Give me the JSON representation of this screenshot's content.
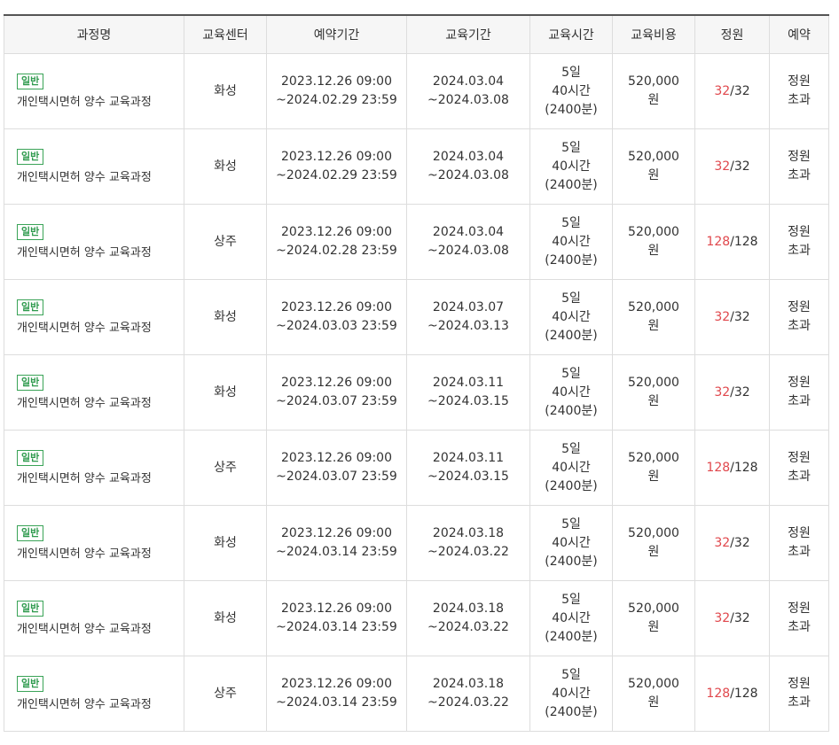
{
  "headers": [
    "과정명",
    "교육센터",
    "예약기간",
    "교육기간",
    "교육시간",
    "교육비용",
    "정원",
    "예약"
  ],
  "rows": [
    {
      "badge": "일반",
      "course": "개인택시면허 양수 교육과정",
      "center": "화성",
      "reserve_start": "2023.12.26 09:00",
      "reserve_end": "~2024.02.29 23:59",
      "edu_start": "2024.03.04",
      "edu_end": "~2024.03.08",
      "time_days": "5일",
      "time_hours": "40시간",
      "time_minutes": "(2400분)",
      "cost_amount": "520,000",
      "cost_unit": "원",
      "cap_current": "32",
      "cap_total": "/32",
      "status_1": "정원",
      "status_2": "초과"
    },
    {
      "badge": "일반",
      "course": "개인택시면허 양수 교육과정",
      "center": "화성",
      "reserve_start": "2023.12.26 09:00",
      "reserve_end": "~2024.02.29 23:59",
      "edu_start": "2024.03.04",
      "edu_end": "~2024.03.08",
      "time_days": "5일",
      "time_hours": "40시간",
      "time_minutes": "(2400분)",
      "cost_amount": "520,000",
      "cost_unit": "원",
      "cap_current": "32",
      "cap_total": "/32",
      "status_1": "정원",
      "status_2": "초과"
    },
    {
      "badge": "일반",
      "course": "개인택시면허 양수 교육과정",
      "center": "상주",
      "reserve_start": "2023.12.26 09:00",
      "reserve_end": "~2024.02.28 23:59",
      "edu_start": "2024.03.04",
      "edu_end": "~2024.03.08",
      "time_days": "5일",
      "time_hours": "40시간",
      "time_minutes": "(2400분)",
      "cost_amount": "520,000",
      "cost_unit": "원",
      "cap_current": "128",
      "cap_total": "/128",
      "status_1": "정원",
      "status_2": "초과"
    },
    {
      "badge": "일반",
      "course": "개인택시면허 양수 교육과정",
      "center": "화성",
      "reserve_start": "2023.12.26 09:00",
      "reserve_end": "~2024.03.03 23:59",
      "edu_start": "2024.03.07",
      "edu_end": "~2024.03.13",
      "time_days": "5일",
      "time_hours": "40시간",
      "time_minutes": "(2400분)",
      "cost_amount": "520,000",
      "cost_unit": "원",
      "cap_current": "32",
      "cap_total": "/32",
      "status_1": "정원",
      "status_2": "초과"
    },
    {
      "badge": "일반",
      "course": "개인택시면허 양수 교육과정",
      "center": "화성",
      "reserve_start": "2023.12.26 09:00",
      "reserve_end": "~2024.03.07 23:59",
      "edu_start": "2024.03.11",
      "edu_end": "~2024.03.15",
      "time_days": "5일",
      "time_hours": "40시간",
      "time_minutes": "(2400분)",
      "cost_amount": "520,000",
      "cost_unit": "원",
      "cap_current": "32",
      "cap_total": "/32",
      "status_1": "정원",
      "status_2": "초과"
    },
    {
      "badge": "일반",
      "course": "개인택시면허 양수 교육과정",
      "center": "상주",
      "reserve_start": "2023.12.26 09:00",
      "reserve_end": "~2024.03.07 23:59",
      "edu_start": "2024.03.11",
      "edu_end": "~2024.03.15",
      "time_days": "5일",
      "time_hours": "40시간",
      "time_minutes": "(2400분)",
      "cost_amount": "520,000",
      "cost_unit": "원",
      "cap_current": "128",
      "cap_total": "/128",
      "status_1": "정원",
      "status_2": "초과"
    },
    {
      "badge": "일반",
      "course": "개인택시면허 양수 교육과정",
      "center": "화성",
      "reserve_start": "2023.12.26 09:00",
      "reserve_end": "~2024.03.14 23:59",
      "edu_start": "2024.03.18",
      "edu_end": "~2024.03.22",
      "time_days": "5일",
      "time_hours": "40시간",
      "time_minutes": "(2400분)",
      "cost_amount": "520,000",
      "cost_unit": "원",
      "cap_current": "32",
      "cap_total": "/32",
      "status_1": "정원",
      "status_2": "초과"
    },
    {
      "badge": "일반",
      "course": "개인택시면허 양수 교육과정",
      "center": "화성",
      "reserve_start": "2023.12.26 09:00",
      "reserve_end": "~2024.03.14 23:59",
      "edu_start": "2024.03.18",
      "edu_end": "~2024.03.22",
      "time_days": "5일",
      "time_hours": "40시간",
      "time_minutes": "(2400분)",
      "cost_amount": "520,000",
      "cost_unit": "원",
      "cap_current": "32",
      "cap_total": "/32",
      "status_1": "정원",
      "status_2": "초과"
    },
    {
      "badge": "일반",
      "course": "개인택시면허 양수 교육과정",
      "center": "상주",
      "reserve_start": "2023.12.26 09:00",
      "reserve_end": "~2024.03.14 23:59",
      "edu_start": "2024.03.18",
      "edu_end": "~2024.03.22",
      "time_days": "5일",
      "time_hours": "40시간",
      "time_minutes": "(2400분)",
      "cost_amount": "520,000",
      "cost_unit": "원",
      "cap_current": "128",
      "cap_total": "/128",
      "status_1": "정원",
      "status_2": "초과"
    }
  ],
  "colors": {
    "badge": "#2e9a4d",
    "cap_current": "#e0474c",
    "header_bg": "#f6f6f6",
    "border": "#dddddd"
  }
}
